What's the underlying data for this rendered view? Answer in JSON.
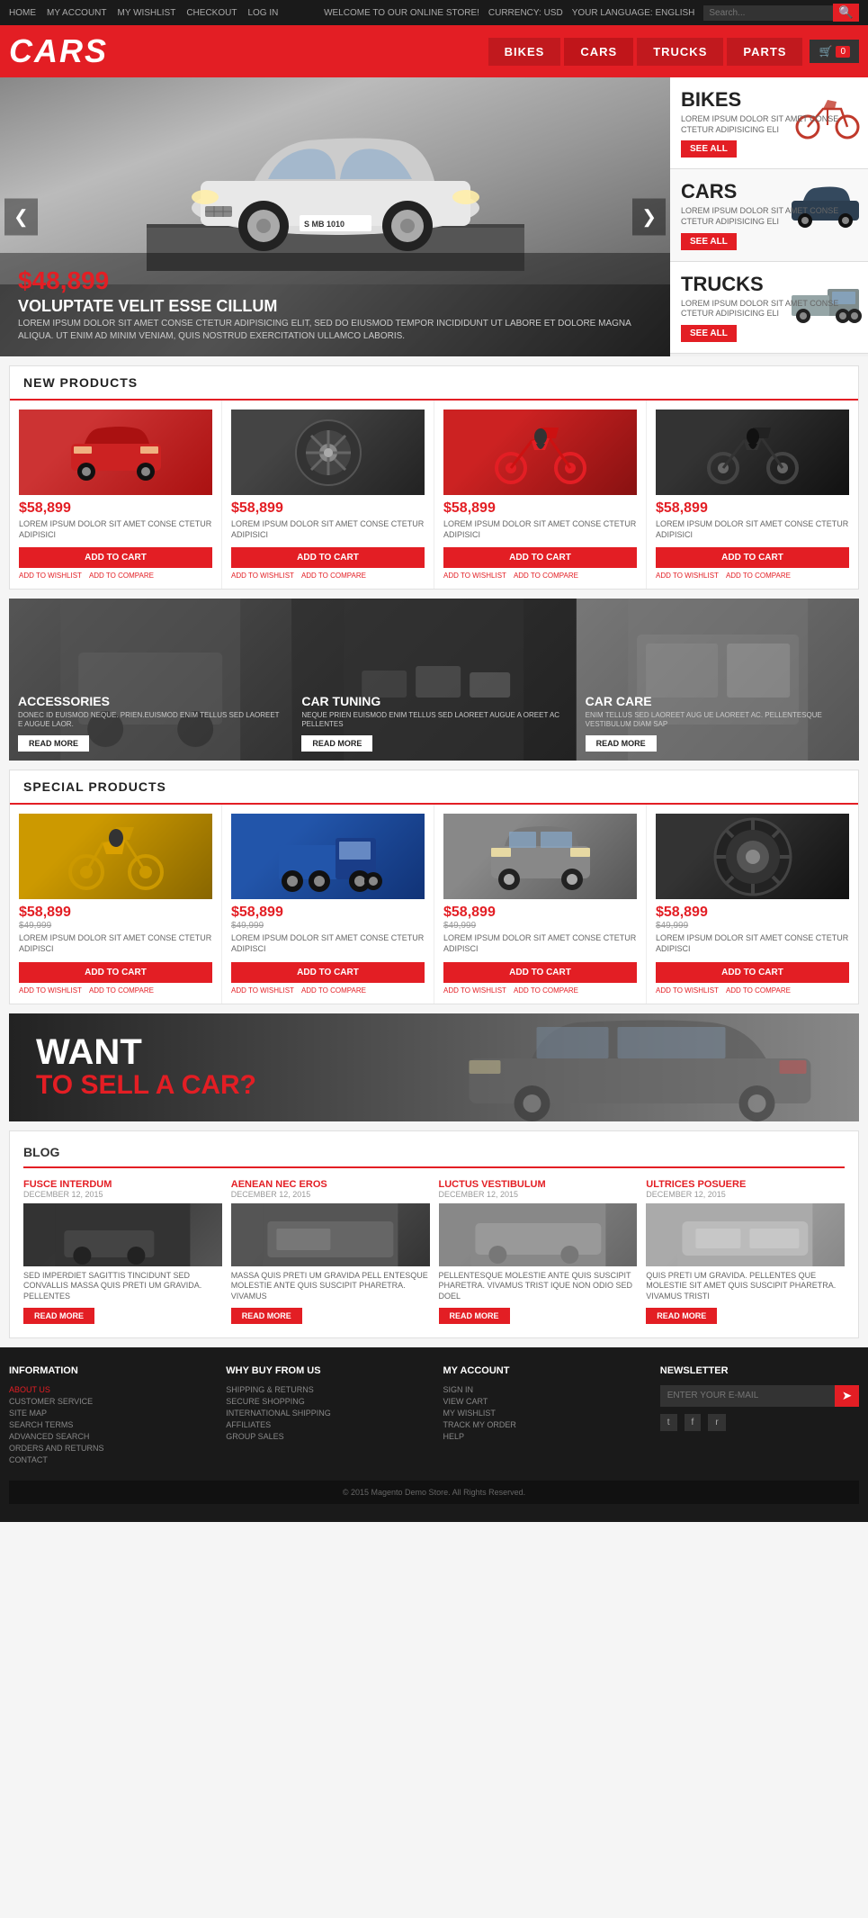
{
  "topbar": {
    "nav": [
      "HOME",
      "MY ACCOUNT",
      "MY WISHLIST",
      "CHECKOUT",
      "LOG IN"
    ],
    "welcome": "WELCOME TO OUR ONLINE STORE!",
    "currency_label": "CURRENCY: USD",
    "language_label": "YOUR LANGUAGE: ENGLISH",
    "search_placeholder": "Search..."
  },
  "header": {
    "logo": "CARS",
    "nav": [
      "BIKES",
      "CARS",
      "TRUCKS",
      "PARTS"
    ],
    "cart_count": "0"
  },
  "hero": {
    "price": "$48,899",
    "title": "VOLUPTATE VELIT ESSE CILLUM",
    "desc": "LOREM IPSUM DOLOR SIT AMET CONSE CTETUR ADIPISICING ELIT, SED DO EIUSMOD TEMPOR INCIDIDUNT UT LABORE ET DOLORE MAGNA ALIQUA. UT ENIM AD MINIM VENIAM, QUIS NOSTRUD EXERCITATION ULLAMCO LABORIS.",
    "plate": "S MB 1010"
  },
  "sidebar_categories": [
    {
      "title": "BIKES",
      "desc": "LOREM IPSUM DOLOR SIT AMET CONSE CTETUR ADIPISICING ELI",
      "btn": "SEE ALL"
    },
    {
      "title": "CARS",
      "desc": "LOREM IPSUM DOLOR SIT AMET CONSE CTETUR ADIPISICING ELI",
      "btn": "SEE ALL"
    },
    {
      "title": "TRUCKS",
      "desc": "LOREM IPSUM DOLOR SIT AMET CONSE CTETUR ADIPISICING ELI",
      "btn": "SEE ALL"
    }
  ],
  "new_products": {
    "section_title": "NEW PRODUCTS",
    "products": [
      {
        "price": "$58,899",
        "desc": "LOREM IPSUM DOLOR SIT AMET CONSE CTETUR ADIPISICI",
        "btn": "ADD TO CART",
        "link1": "ADD TO WISHLIST",
        "link2": "ADD TO COMPARE",
        "img_type": "red-car"
      },
      {
        "price": "$58,899",
        "desc": "LOREM IPSUM DOLOR SIT AMET CONSE CTETUR ADIPISICI",
        "btn": "ADD TO CART",
        "link1": "ADD TO WISHLIST",
        "link2": "ADD TO COMPARE",
        "img_type": "wheel"
      },
      {
        "price": "$58,899",
        "desc": "LOREM IPSUM DOLOR SIT AMET CONSE CTETUR ADIPISICI",
        "btn": "ADD TO CART",
        "link1": "ADD TO WISHLIST",
        "link2": "ADD TO COMPARE",
        "img_type": "bike-red"
      },
      {
        "price": "$58,899",
        "desc": "LOREM IPSUM DOLOR SIT AMET CONSE CTETUR ADIPISICI",
        "btn": "ADD TO CART",
        "link1": "ADD TO WISHLIST",
        "link2": "ADD TO COMPARE",
        "img_type": "bike-blk"
      }
    ]
  },
  "banners": [
    {
      "title": "ACCESSORIES",
      "desc": "DONEC ID EUISMOD NEQUE. PRIEN.EUISMOD ENIM TELLUS SED LAOREET E AUGUE LAOR.",
      "btn": "READ MORE"
    },
    {
      "title": "CAR TUNING",
      "desc": "NEQUE PRIEN EUISMOD ENIM TELLUS SED LAOREET AUGUE A OREET AC PELLENTES",
      "btn": "READ MORE"
    },
    {
      "title": "CAR CARE",
      "desc": "ENIM TELLUS SED LAOREET AUG UE LAOREET AC. PELLENTESQUE VESTIBULUM DIAM SAP",
      "btn": "READ MORE"
    }
  ],
  "special_products": {
    "section_title": "SPECIAL PRODUCTS",
    "products": [
      {
        "price": "$58,899",
        "old_price": "$49,999",
        "desc": "LOREM IPSUM DOLOR SIT AMET CONSE CTETUR ADIPISCI",
        "btn": "ADD TO CART",
        "link1": "ADD TO WISHLIST",
        "link2": "ADD TO COMPARE",
        "img_type": "moto-ylw"
      },
      {
        "price": "$58,899",
        "old_price": "$49,999",
        "desc": "LOREM IPSUM DOLOR SIT AMET CONSE CTETUR ADIPISCI",
        "btn": "ADD TO CART",
        "link1": "ADD TO WISHLIST",
        "link2": "ADD TO COMPARE",
        "img_type": "truck-blu"
      },
      {
        "price": "$58,899",
        "old_price": "$49,999",
        "desc": "LOREM IPSUM DOLOR SIT AMET CONSE CTETUR ADIPISCI",
        "btn": "ADD TO CART",
        "link1": "ADD TO WISHLIST",
        "link2": "ADD TO COMPARE",
        "img_type": "suv"
      },
      {
        "price": "$58,899",
        "old_price": "$49,999",
        "desc": "LOREM IPSUM DOLOR SIT AMET CONSE CTETUR ADIPISCI",
        "btn": "ADD TO CART",
        "link1": "ADD TO WISHLIST",
        "link2": "ADD TO COMPARE",
        "img_type": "tire"
      }
    ]
  },
  "sell_banner": {
    "line1": "WANT",
    "line2": "TO SELL A CAR?"
  },
  "blog": {
    "section_title": "BLOG",
    "posts": [
      {
        "title": "FUSCE INTERDUM",
        "date": "DECEMBER 12, 2015",
        "desc": "SED IMPERDIET SAGITTIS TINCIDUNT SED CONVALLIS MASSA QUIS PRETI UM GRAVIDA. PELLENTES",
        "btn": "READ MORE",
        "img_type": "blog-1"
      },
      {
        "title": "AENEAN NEC EROS",
        "date": "DECEMBER 12, 2015",
        "desc": "MASSA QUIS PRETI UM GRAVIDA PELL ENTESQUE MOLESTIE ANTE QUIS SUSCIPIT PHARETRA. VIVAMUS",
        "btn": "READ MORE",
        "img_type": "blog-2"
      },
      {
        "title": "LUCTUS VESTIBULUM",
        "date": "DECEMBER 12, 2015",
        "desc": "PELLENTESQUE MOLESTIE ANTE QUIS SUSCIPIT PHARETRA. VIVAMUS TRIST IQUE NON ODIO SED DOEL",
        "btn": "READ MORE",
        "img_type": "blog-3"
      },
      {
        "title": "ULTRICES POSUERE",
        "date": "DECEMBER 12, 2015",
        "desc": "QUIS PRETI UM GRAVIDA. PELLENTES QUE MOLESTIE SIT AMET QUIS SUSCIPIT PHARETRA. VIVAMUS TRISTI",
        "btn": "READ MORE",
        "img_type": "blog-4"
      }
    ]
  },
  "footer": {
    "information": {
      "title": "INFORMATION",
      "links": [
        "ABOUT US",
        "CUSTOMER SERVICE",
        "SITE MAP",
        "SEARCH TERMS",
        "ADVANCED SEARCH",
        "ORDERS AND RETURNS",
        "CONTACT"
      ]
    },
    "why": {
      "title": "WHY BUY FROM US",
      "links": [
        "SHIPPING & RETURNS",
        "SECURE SHOPPING",
        "INTERNATIONAL SHIPPING",
        "AFFILIATES",
        "GROUP SALES"
      ]
    },
    "account": {
      "title": "MY ACCOUNT",
      "links": [
        "SIGN IN",
        "VIEW CART",
        "MY WISHLIST",
        "TRACK MY ORDER",
        "HELP"
      ]
    },
    "newsletter": {
      "title": "NEWSLETTER",
      "placeholder": "ENTER YOUR E-MAIL"
    },
    "social": [
      "t",
      "f",
      "r"
    ],
    "copyright": "© 2015 Magento Demo Store. All Rights Reserved."
  }
}
